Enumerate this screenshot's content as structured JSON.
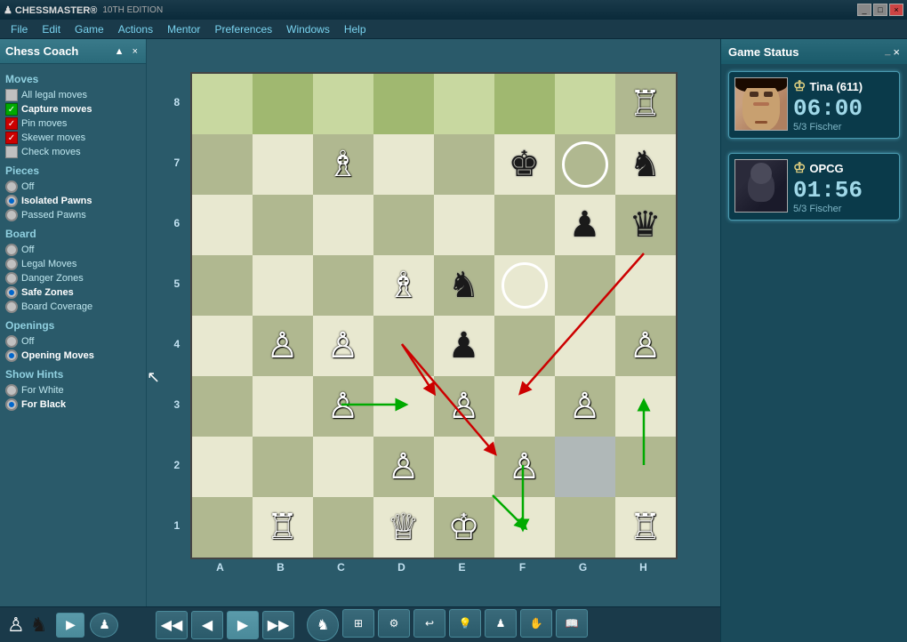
{
  "titlebar": {
    "logo": "CHESSMASTER",
    "subtitle": "10TH EDITION",
    "controls": [
      "_",
      "□",
      "×"
    ]
  },
  "menubar": {
    "items": [
      "File",
      "Edit",
      "Game",
      "Actions",
      "Mentor",
      "Preferences",
      "Windows",
      "Help"
    ]
  },
  "coach": {
    "title": "Chess Coach",
    "expand_label": "▲",
    "close_label": "×",
    "sections": {
      "moves": {
        "header": "Moves",
        "options": [
          {
            "label": "All legal moves",
            "state": "empty"
          },
          {
            "label": "Capture moves",
            "state": "green"
          },
          {
            "label": "Pin moves",
            "state": "red"
          },
          {
            "label": "Skewer moves",
            "state": "red"
          },
          {
            "label": "Check moves",
            "state": "empty"
          }
        ]
      },
      "pieces": {
        "header": "Pieces",
        "options": [
          {
            "label": "Off",
            "state": "radio-empty"
          },
          {
            "label": "Isolated Pawns",
            "state": "radio-filled"
          },
          {
            "label": "Passed Pawns",
            "state": "radio-empty"
          }
        ]
      },
      "board": {
        "header": "Board",
        "options": [
          {
            "label": "Off",
            "state": "radio-empty"
          },
          {
            "label": "Legal Moves",
            "state": "radio-empty"
          },
          {
            "label": "Danger Zones",
            "state": "radio-empty"
          },
          {
            "label": "Safe Zones",
            "state": "radio-filled"
          },
          {
            "label": "Board Coverage",
            "state": "radio-empty"
          }
        ]
      },
      "openings": {
        "header": "Openings",
        "options": [
          {
            "label": "Off",
            "state": "radio-empty"
          },
          {
            "label": "Opening Moves",
            "state": "radio-filled"
          }
        ]
      },
      "hints": {
        "header": "Show Hints",
        "options": [
          {
            "label": "For White",
            "state": "radio-empty"
          },
          {
            "label": "For Black",
            "state": "radio-filled"
          }
        ]
      }
    }
  },
  "board": {
    "ranks": [
      "8",
      "7",
      "6",
      "5",
      "4",
      "3",
      "2",
      "1"
    ],
    "files": [
      "A",
      "B",
      "C",
      "D",
      "E",
      "F",
      "G",
      "H"
    ]
  },
  "game_status": {
    "title": "Game Status",
    "close_label": "×",
    "player1": {
      "name": "Tina (611)",
      "time": "06:00",
      "rating": "5/3 Fischer",
      "active": true
    },
    "player2": {
      "name": "OPCG",
      "time": "01:56",
      "rating": "5/3 Fischer",
      "active": false
    }
  },
  "toolbar": {
    "buttons": [
      "◀◀",
      "◀",
      "▶",
      "▶▶"
    ]
  }
}
